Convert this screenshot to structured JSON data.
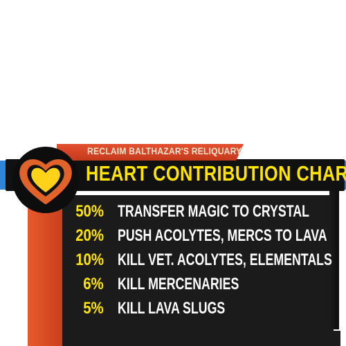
{
  "banner": {
    "subtitle": "RECLAIM BALTHAZAR'S RELIQUARY",
    "title": "HEART CONTRIBUTION CHART",
    "icon": "heart-icon"
  },
  "colors": {
    "accent_yellow": "#ffe400",
    "accent_red": "#d84a26",
    "accent_blue": "#2f86d9",
    "panel": "#1b1b1b"
  },
  "rows": [
    {
      "percent": "50%",
      "label": "TRANSFER MAGIC TO CRYSTAL"
    },
    {
      "percent": "20%",
      "label": "PUSH ACOLYTES, MERCS TO LAVA"
    },
    {
      "percent": "10%",
      "label": "KILL VET. ACOLYTES, ELEMENTALS"
    },
    {
      "percent": "6%",
      "label": "KILL MERCENARIES"
    },
    {
      "percent": "5%",
      "label": "KILL LAVA SLUGS"
    }
  ]
}
